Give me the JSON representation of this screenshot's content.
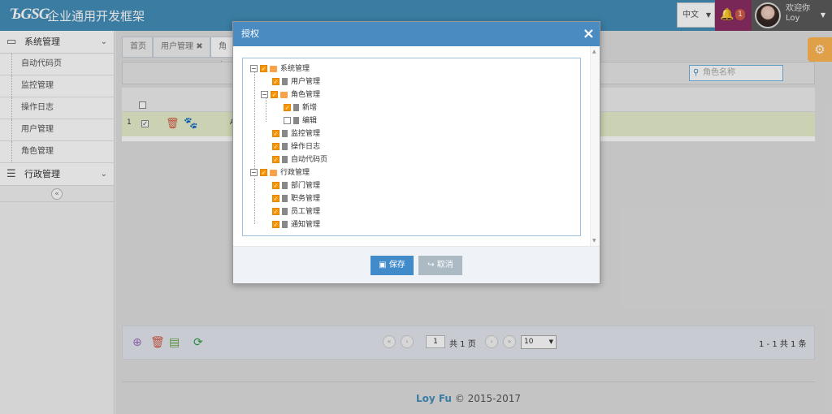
{
  "header": {
    "logo": "ЪGSG",
    "title": "企业通用开发框架",
    "language": "中文",
    "notification_count": "1",
    "welcome": "欢迎你",
    "username": "Loy"
  },
  "sidebar": {
    "group1": "系统管理",
    "items": [
      "自动代码页",
      "监控管理",
      "操作日志",
      "用户管理",
      "角色管理"
    ],
    "group2": "行政管理",
    "collapse": "«"
  },
  "tabs": [
    {
      "label": "首页"
    },
    {
      "label": "用户管理",
      "close": "✖"
    },
    {
      "label": "角色"
    }
  ],
  "search": {
    "placeholder": "角色名称"
  },
  "grid": {
    "row_number": "1",
    "row_text": "A"
  },
  "pager": {
    "page_input": "1",
    "total_pages": "共 1 页",
    "page_size": "10",
    "summary": "1 - 1   共 1 条"
  },
  "footer": {
    "brand": "Loy Fu",
    "copyright": "© 2015-2017"
  },
  "modal": {
    "title": "授权",
    "close": "×",
    "tree": {
      "n0": "系统管理",
      "n1": "用户管理",
      "n2": "角色管理",
      "n3": "新增",
      "n4": "编辑",
      "n5": "监控管理",
      "n6": "操作日志",
      "n7": "自动代码页",
      "n8": "行政管理",
      "n9": "部门管理",
      "n10": "职务管理",
      "n11": "员工管理",
      "n12": "通知管理"
    },
    "save": "保存",
    "cancel": "取消"
  },
  "colors": {
    "header": "#438eb9",
    "accent_orange": "#f89406",
    "save": "#428bca",
    "cancel": "#abbac3",
    "highlight_row": "#e6f0cc"
  }
}
